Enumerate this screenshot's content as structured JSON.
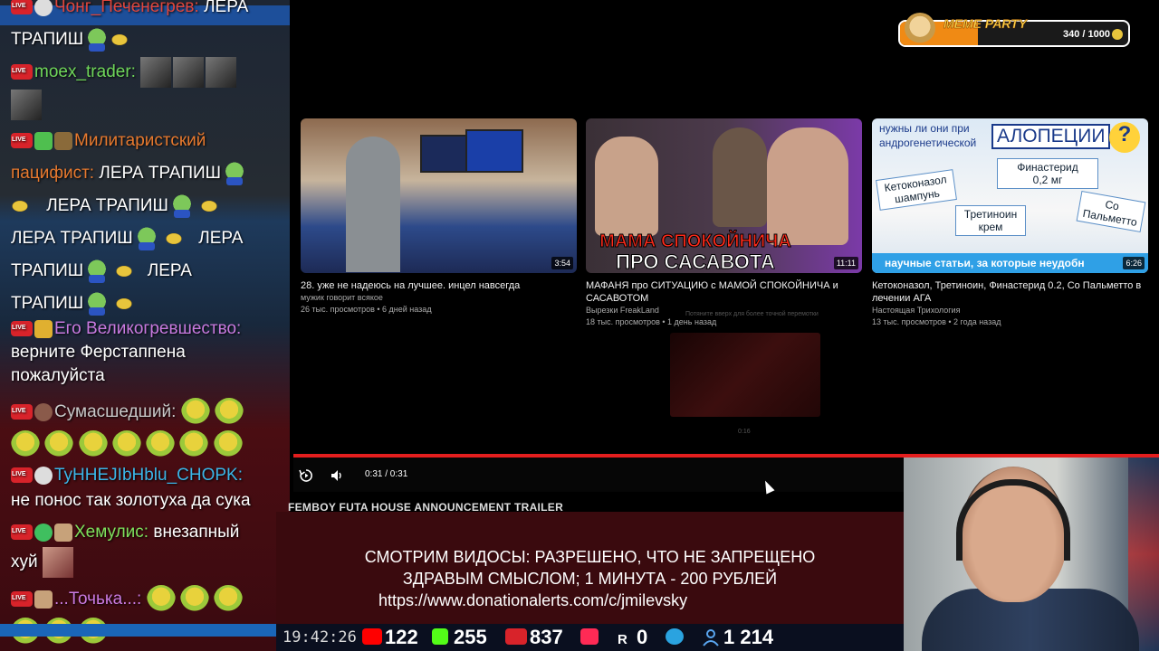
{
  "chat": {
    "messages": [
      {
        "user": "Чонг_Печенегрев:",
        "text": "ЛЕРА",
        "text2": "ТРАПИШ",
        "user_color": "#e0463c"
      },
      {
        "user": "moex_trader:",
        "user_color": "#6fd65a"
      },
      {
        "user": "Милитаристский",
        "user2": "пацифист:",
        "text": "ЛЕРА ТРАПИШ",
        "user_color": "#e7792e",
        "lines": [
          "ЛЕРА ТРАПИШ",
          "ЛЕРА ТРАПИШ",
          "ЛЕРА",
          "ТРАПИШ",
          "ЛЕРА",
          "ТРАПИШ"
        ]
      },
      {
        "user": "Его Великогревшество:",
        "text": "верните Ферстаппена",
        "text2": "пожалуйста",
        "user_color": "#c97ae0"
      },
      {
        "user": "Сумасшедший:",
        "user_color": "#c9c9c9"
      },
      {
        "user": "TyHHEJIbHblu_CHOPK:",
        "text": "не понос так золотуха да сука",
        "user_color": "#3bb6e8"
      },
      {
        "user": "Хемулис:",
        "text": "внезапный",
        "text2": "хуй",
        "user_color": "#7ee05c"
      },
      {
        "user": "...Точька...:",
        "user_color": "#c97ae0"
      }
    ]
  },
  "videos": [
    {
      "title": "28. уже не надеюсь на лучшее. инцел навсегда",
      "channel": "мужик говорит всякое",
      "meta": "26 тыс. просмотров • 6 дней назад",
      "duration": "3:54"
    },
    {
      "title": "МАФАНЯ про СИТУАЦИЮ с МАМОЙ СПОКОЙНИЧА и САСАВОТОМ",
      "channel": "Вырезки FreakLand",
      "meta": "18 тыс. просмотров • 1 день назад",
      "duration": "11:11",
      "caption1": "МАМА СПОКОЙНИЧА",
      "caption2": "ПРО САСАВОТА"
    },
    {
      "title": "Кетоконазол, Третиноин, Финастерид 0.2, Со Пальметто в лечении АГА",
      "channel": "Настоящая Трихология",
      "meta": "13 тыс. просмотров • 2 года назад",
      "duration": "6:26",
      "t_head1": "нужны ли они при",
      "t_head2": "андрогенетической",
      "t_head3": "АЛОПЕЦИИ",
      "t_k1": "Кетоконазол",
      "t_k2": "шампунь",
      "t_f1": "Финастерид",
      "t_f2": "0,2 мг",
      "t_t1": "Третиноин",
      "t_t2": "крем",
      "t_s1": "Со",
      "t_s2": "Пальметто",
      "t_bar": "научные статьи, за которые неудобн"
    }
  ],
  "player": {
    "time": "0:31 / 0:31",
    "video_title": "FEMBOY FUTA HOUSE ANNOUNCEMENT TRAILER",
    "faint_hint": "Потяните вверх для более точной перемотки",
    "faint_time": "0:16",
    "progress": 1.0
  },
  "banner": {
    "line1": "СМОТРИМ ВИДОСЫ: РАЗРЕШЕНО, ЧТО НЕ ЗАПРЕЩЕНО",
    "line2": "ЗДРАВЫМ СМЫСЛОМ; 1 МИНУТА - 200 РУБЛЕЙ",
    "line3": "https://www.donationalerts.com/c/jmilevsky"
  },
  "meme_party": {
    "title": "MEME PARTY",
    "count": "340 / 1000",
    "fraction": 0.34
  },
  "stats": {
    "clock": "19:42:26",
    "youtube": "122",
    "kick": "255",
    "twitch_live": "837",
    "rutube": "0",
    "telegram_users": "1 214",
    "colors": {
      "youtube": "#ff0000",
      "kick": "#53fc18",
      "live": "#d8232a",
      "rutube": "#ff2a55",
      "telegram": "#2aa3e0"
    }
  }
}
